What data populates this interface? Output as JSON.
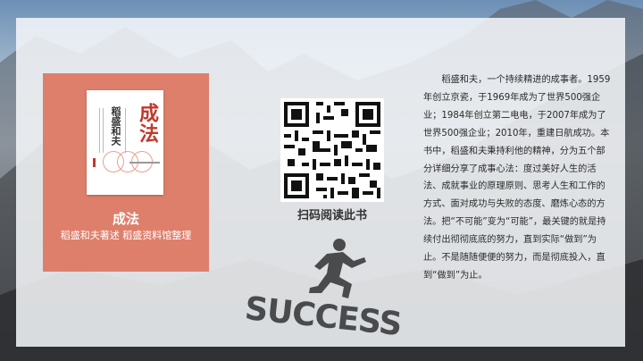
{
  "book": {
    "cover_title": "成法",
    "cover_author": "稻盛和夫",
    "title": "成法",
    "subtitle": "稻盛和夫著述 稻盛资料馆整理"
  },
  "qr": {
    "caption": "扫码阅读此书"
  },
  "success": {
    "text": "SUCCESS"
  },
  "description": {
    "text": "稻盛和夫，一个持续精进的成事者。1959年创立京瓷，于1969年成为了世界500强企业；1984年创立第二电电，于2007年成为了世界500强企业；2010年，重建日航成功。本书中，稻盛和夫秉持利他的精神，分为五个部分详细分享了成事心法：度过美好人生的活法、成就事业的原理原则、思考人生和工作的方式、面对成功与失败的态度、磨炼心态的方法。把“不可能”变为“可能”，最关键的就是持续付出彻彻底底的努力，直到实际“做到”为止。不是随随便便的努力，而是彻底投入，直到“做到”为止。"
  }
}
